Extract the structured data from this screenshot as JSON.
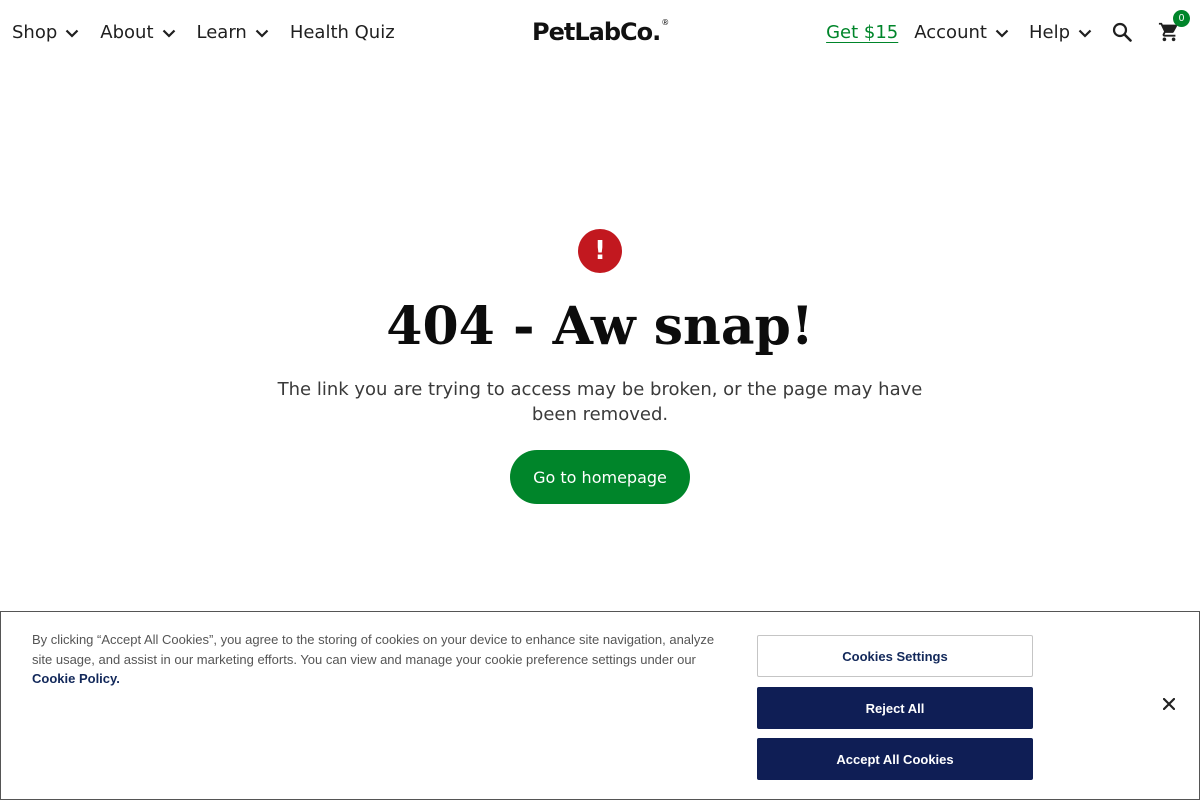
{
  "header": {
    "nav_left": [
      {
        "label": "Shop",
        "has_dropdown": true
      },
      {
        "label": "About",
        "has_dropdown": true
      },
      {
        "label": "Learn",
        "has_dropdown": true
      },
      {
        "label": "Health Quiz",
        "has_dropdown": false
      }
    ],
    "logo": {
      "text": "PetLabCo.",
      "mark": "®"
    },
    "promo_link": "Get $15",
    "account_label": "Account",
    "help_label": "Help",
    "search_icon": "search-icon",
    "cart_icon": "cart-icon",
    "cart_count": "0"
  },
  "main": {
    "error_icon_glyph": "!",
    "title": "404 - Aw snap!",
    "description": "The link you are trying to access may be broken, or the page may have been removed.",
    "button_label": "Go to homepage"
  },
  "cookie_banner": {
    "text": "By clicking “Accept All Cookies”, you agree to the storing of cookies on your device to enhance site navigation, analyze site usage, and assist in our marketing efforts. You can view and manage your cookie preference settings under our",
    "policy_link": "Cookie Policy.",
    "settings_label": "Cookies Settings",
    "reject_label": "Reject All",
    "accept_label": "Accept All Cookies",
    "close_icon": "close-icon"
  },
  "colors": {
    "brand_green": "#00852a",
    "error_red": "#c2181f",
    "navy": "#0f1e55"
  }
}
